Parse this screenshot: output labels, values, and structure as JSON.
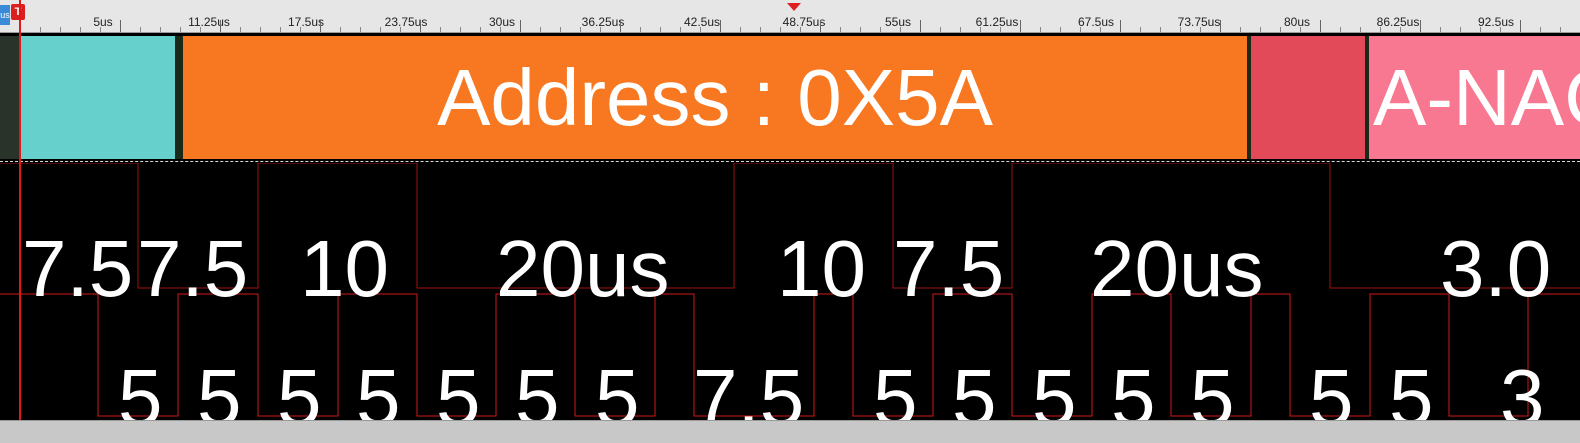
{
  "ruler": {
    "ts_badge": "us",
    "trigger_flag": "T",
    "labels": [
      "5us",
      "11.25us",
      "17.5us",
      "23.75us",
      "30us",
      "36.25us",
      "42.5us",
      "48.75us",
      "55us",
      "61.25us",
      "67.5us",
      "73.75us",
      "80us",
      "86.25us",
      "92.5us"
    ]
  },
  "decode": {
    "segments": [
      "",
      "",
      "Address : 0X5A",
      "",
      "A-NACK"
    ],
    "colors": {
      "idle": "#2a332a",
      "start": "#66d0cc",
      "address": "#f77820",
      "rw": "#e24a5a",
      "nack": "#f77890"
    }
  },
  "timing": {
    "high_labels": [
      "7.5",
      "7.5",
      "10",
      "20us",
      "10",
      "7.5",
      "20us",
      "3.0"
    ],
    "low_labels": [
      "5",
      "5",
      "5",
      "5",
      "5",
      "5",
      "5",
      "7.5",
      "5",
      "5",
      "5",
      "5",
      "5",
      "5",
      "5",
      "3"
    ],
    "trace_color": "#d01818"
  }
}
